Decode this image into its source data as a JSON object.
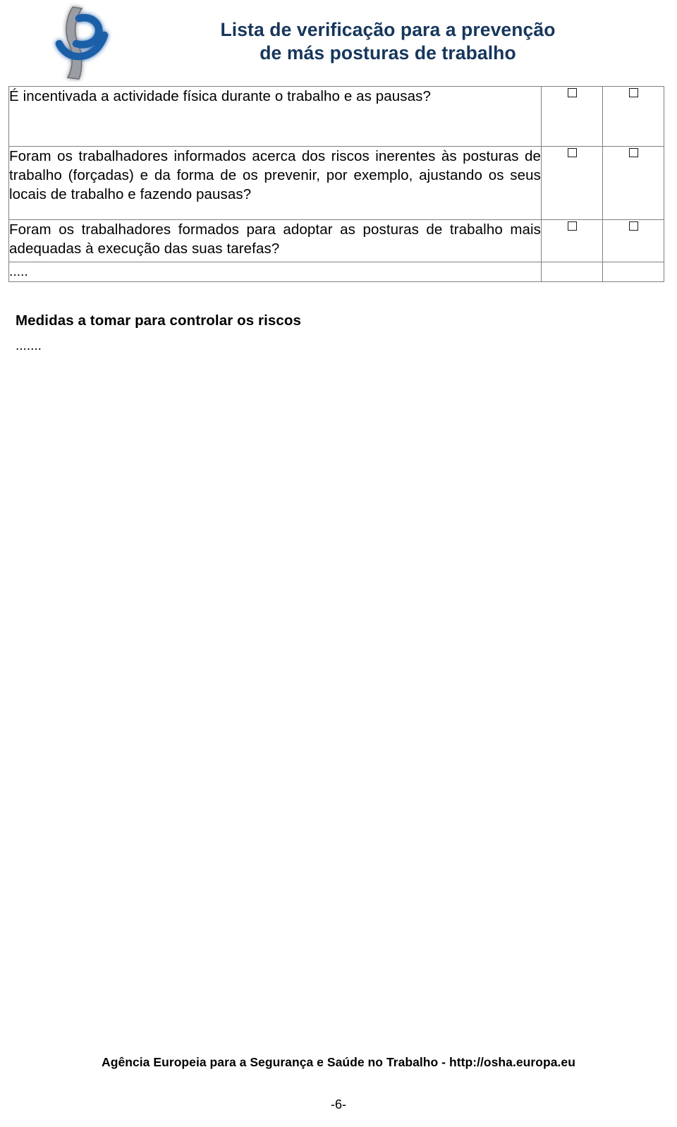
{
  "header": {
    "logo_name": "eu-osha-logo",
    "title_line_1": "Lista de verificação para a prevenção",
    "title_line_2": "de más posturas de trabalho",
    "title_color": "#16365c"
  },
  "checklist": {
    "rows": [
      {
        "question": "É incentivada a actividade física durante o trabalho e as pausas?",
        "checkbox_1": "",
        "checkbox_2": "",
        "has_checkboxes": true
      },
      {
        "question": "Foram os trabalhadores informados acerca dos riscos inerentes às posturas de trabalho (forçadas) e da forma de os prevenir, por exemplo, ajustando os seus locais de trabalho e fazendo pausas?",
        "checkbox_1": "",
        "checkbox_2": "",
        "has_checkboxes": true
      },
      {
        "question": "Foram os trabalhadores formados para adoptar as posturas de trabalho mais adequadas à execução das suas tarefas?",
        "checkbox_1": "",
        "checkbox_2": "",
        "has_checkboxes": true
      },
      {
        "question": ".....",
        "checkbox_1": "",
        "checkbox_2": "",
        "has_checkboxes": false
      }
    ],
    "border_color": "#808080",
    "checkbox_name": "empty-checkbox"
  },
  "measures": {
    "heading": "Medidas a tomar para controlar os riscos",
    "dots": "......."
  },
  "footer": {
    "agency_text": "Agência Europeia para a Segurança e Saúde no Trabalho - http://osha.europa.eu",
    "page_number": "-6-"
  }
}
